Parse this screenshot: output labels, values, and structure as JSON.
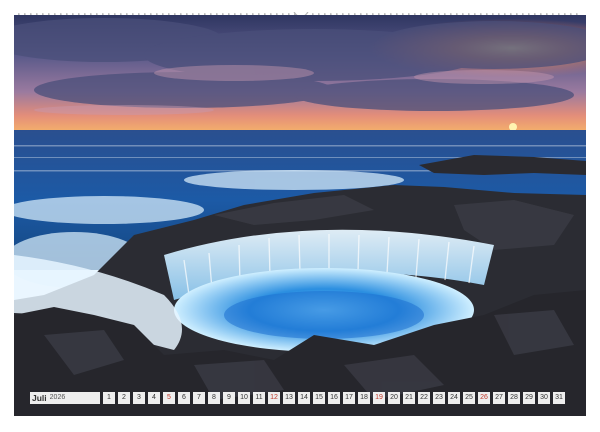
{
  "calendar": {
    "month": "Juli",
    "year": "2026",
    "days": [
      {
        "n": "1",
        "we": false
      },
      {
        "n": "2",
        "we": false
      },
      {
        "n": "3",
        "we": false
      },
      {
        "n": "4",
        "we": false
      },
      {
        "n": "5",
        "we": true
      },
      {
        "n": "6",
        "we": false
      },
      {
        "n": "7",
        "we": false
      },
      {
        "n": "8",
        "we": false
      },
      {
        "n": "9",
        "we": false
      },
      {
        "n": "10",
        "we": false
      },
      {
        "n": "11",
        "we": false
      },
      {
        "n": "12",
        "we": true
      },
      {
        "n": "13",
        "we": false
      },
      {
        "n": "14",
        "we": false
      },
      {
        "n": "15",
        "we": false
      },
      {
        "n": "16",
        "we": false
      },
      {
        "n": "17",
        "we": false
      },
      {
        "n": "18",
        "we": false
      },
      {
        "n": "19",
        "we": true
      },
      {
        "n": "20",
        "we": false
      },
      {
        "n": "21",
        "we": false
      },
      {
        "n": "22",
        "we": false
      },
      {
        "n": "23",
        "we": false
      },
      {
        "n": "24",
        "we": false
      },
      {
        "n": "25",
        "we": false
      },
      {
        "n": "26",
        "we": true
      },
      {
        "n": "27",
        "we": false
      },
      {
        "n": "28",
        "we": false
      },
      {
        "n": "29",
        "we": false
      },
      {
        "n": "30",
        "we": false
      },
      {
        "n": "31",
        "we": false
      }
    ]
  },
  "colors": {
    "weekend": "#c0392b",
    "weekday": "#333333",
    "sky_top": "#3b4470",
    "sun": "#ffb347",
    "water": "#1c63b8"
  }
}
